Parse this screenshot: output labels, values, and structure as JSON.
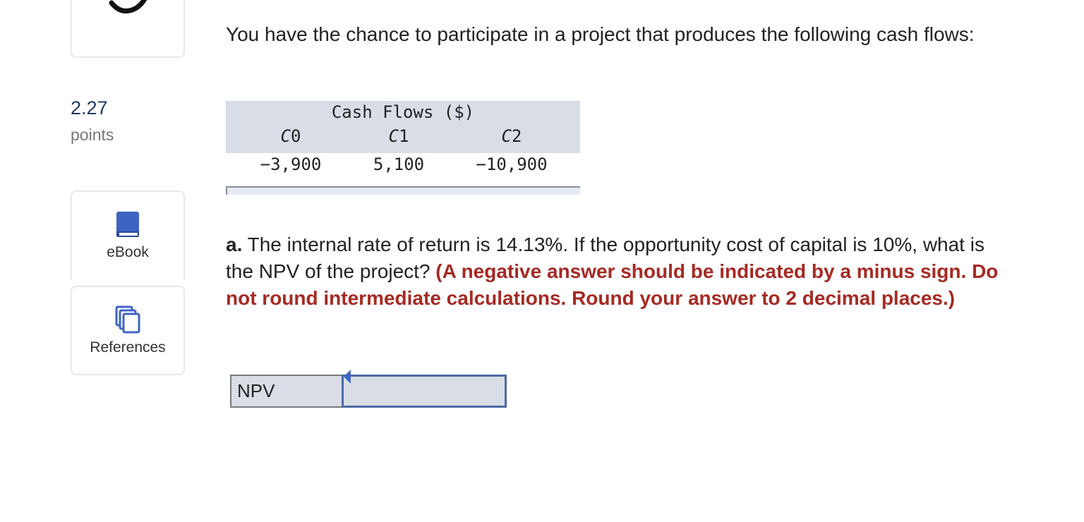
{
  "sidebar": {
    "points_value": "2.27",
    "points_label": "points",
    "ebook_label": "eBook",
    "references_label": "References"
  },
  "question": {
    "intro": "You have the chance to participate in a project that produces the following cash flows:",
    "part_letter": "a.",
    "prompt": " The internal rate of return is 14.13%. If the opportunity cost of capital is 10%, what is the NPV of the project? ",
    "instructions": "(A negative answer should be indicated by a minus sign. Do not round intermediate calculations. Round your answer to 2 decimal places.)"
  },
  "cash_flows": {
    "title": "Cash Flows ($)",
    "columns": [
      {
        "letter": "C",
        "sub": "0"
      },
      {
        "letter": "C",
        "sub": "1"
      },
      {
        "letter": "C",
        "sub": "2"
      }
    ],
    "values": [
      "−3,900",
      "5,100",
      "−10,900"
    ]
  },
  "answer": {
    "label": "NPV",
    "value": ""
  },
  "colors": {
    "points_value": "#1f3a68",
    "instruction_red": "#a52a23",
    "table_header_bg": "#d9dde6",
    "input_border": "#4a6aa5",
    "icon_blue": "#3d64c2"
  },
  "icons": {
    "top_card": "check-icon",
    "ebook": "book-icon",
    "references": "copy-icon"
  }
}
